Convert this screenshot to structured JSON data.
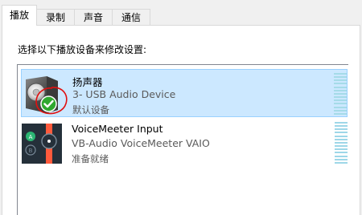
{
  "tabs": [
    {
      "label": "播放",
      "active": true
    },
    {
      "label": "录制",
      "active": false
    },
    {
      "label": "声音",
      "active": false
    },
    {
      "label": "通信",
      "active": false
    }
  ],
  "instruction": "选择以下播放设备来修改设置:",
  "devices": [
    {
      "name": "扬声器",
      "description": "3- USB Audio Device",
      "status": "默认设备",
      "icon": "speaker-icon",
      "default_check_icon": "green-check-icon",
      "selected": true
    },
    {
      "name": "VoiceMeeter Input",
      "description": "VB-Audio VoiceMeeter VAIO",
      "status": "准备就绪",
      "icon": "voicemeeter-icon",
      "selected": false
    }
  ],
  "colors": {
    "selection_bg": "#cce8ff",
    "selection_border": "#99d1ff",
    "meter": "#9ed7e8",
    "check_green": "#2fa82f",
    "annotation_red": "#e01010"
  }
}
